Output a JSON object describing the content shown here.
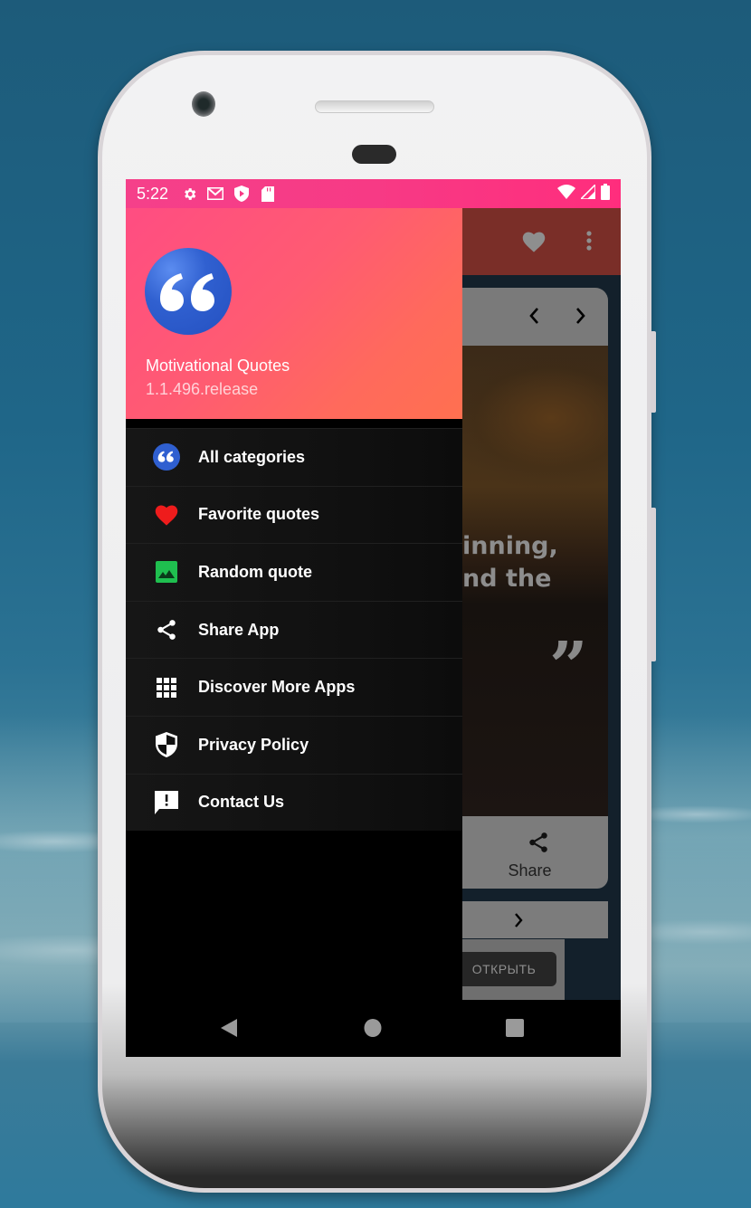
{
  "status_bar": {
    "time": "5:22",
    "left_icons": [
      "settings-icon",
      "gmail-icon",
      "play-protect-icon",
      "sd-card-icon"
    ],
    "right_icons": [
      "wifi-icon",
      "signal-icon",
      "battery-icon"
    ]
  },
  "drawer": {
    "header": {
      "app_name": "Motivational Quotes",
      "version": "1.1.496.release",
      "logo_icon": "quote-logo-icon"
    },
    "items": [
      {
        "label": "All categories",
        "icon": "quote-circle-icon",
        "icon_color": "#2f5fd0"
      },
      {
        "label": "Favorite quotes",
        "icon": "heart-icon",
        "icon_color": "#ee1c1c"
      },
      {
        "label": "Random quote",
        "icon": "image-icon",
        "icon_color": "#1fbf4f"
      },
      {
        "label": "Share App",
        "icon": "share-icon",
        "icon_color": "#ffffff"
      },
      {
        "label": "Discover More Apps",
        "icon": "apps-grid-icon",
        "icon_color": "#ffffff"
      },
      {
        "label": "Privacy Policy",
        "icon": "shield-icon",
        "icon_color": "#ffffff"
      },
      {
        "label": "Contact Us",
        "icon": "feedback-icon",
        "icon_color": "#ffffff"
      }
    ]
  },
  "background_app": {
    "quote_fragment_line1": "inning,",
    "quote_fragment_line2": "nd the",
    "share_label": "Share",
    "ad_button_label": "ОТКРЫТЬ"
  },
  "colors": {
    "status_bar": "#ff2d7d",
    "header_start": "#ff4d82",
    "header_end": "#ff7050",
    "drawer_bg": "#000000"
  }
}
